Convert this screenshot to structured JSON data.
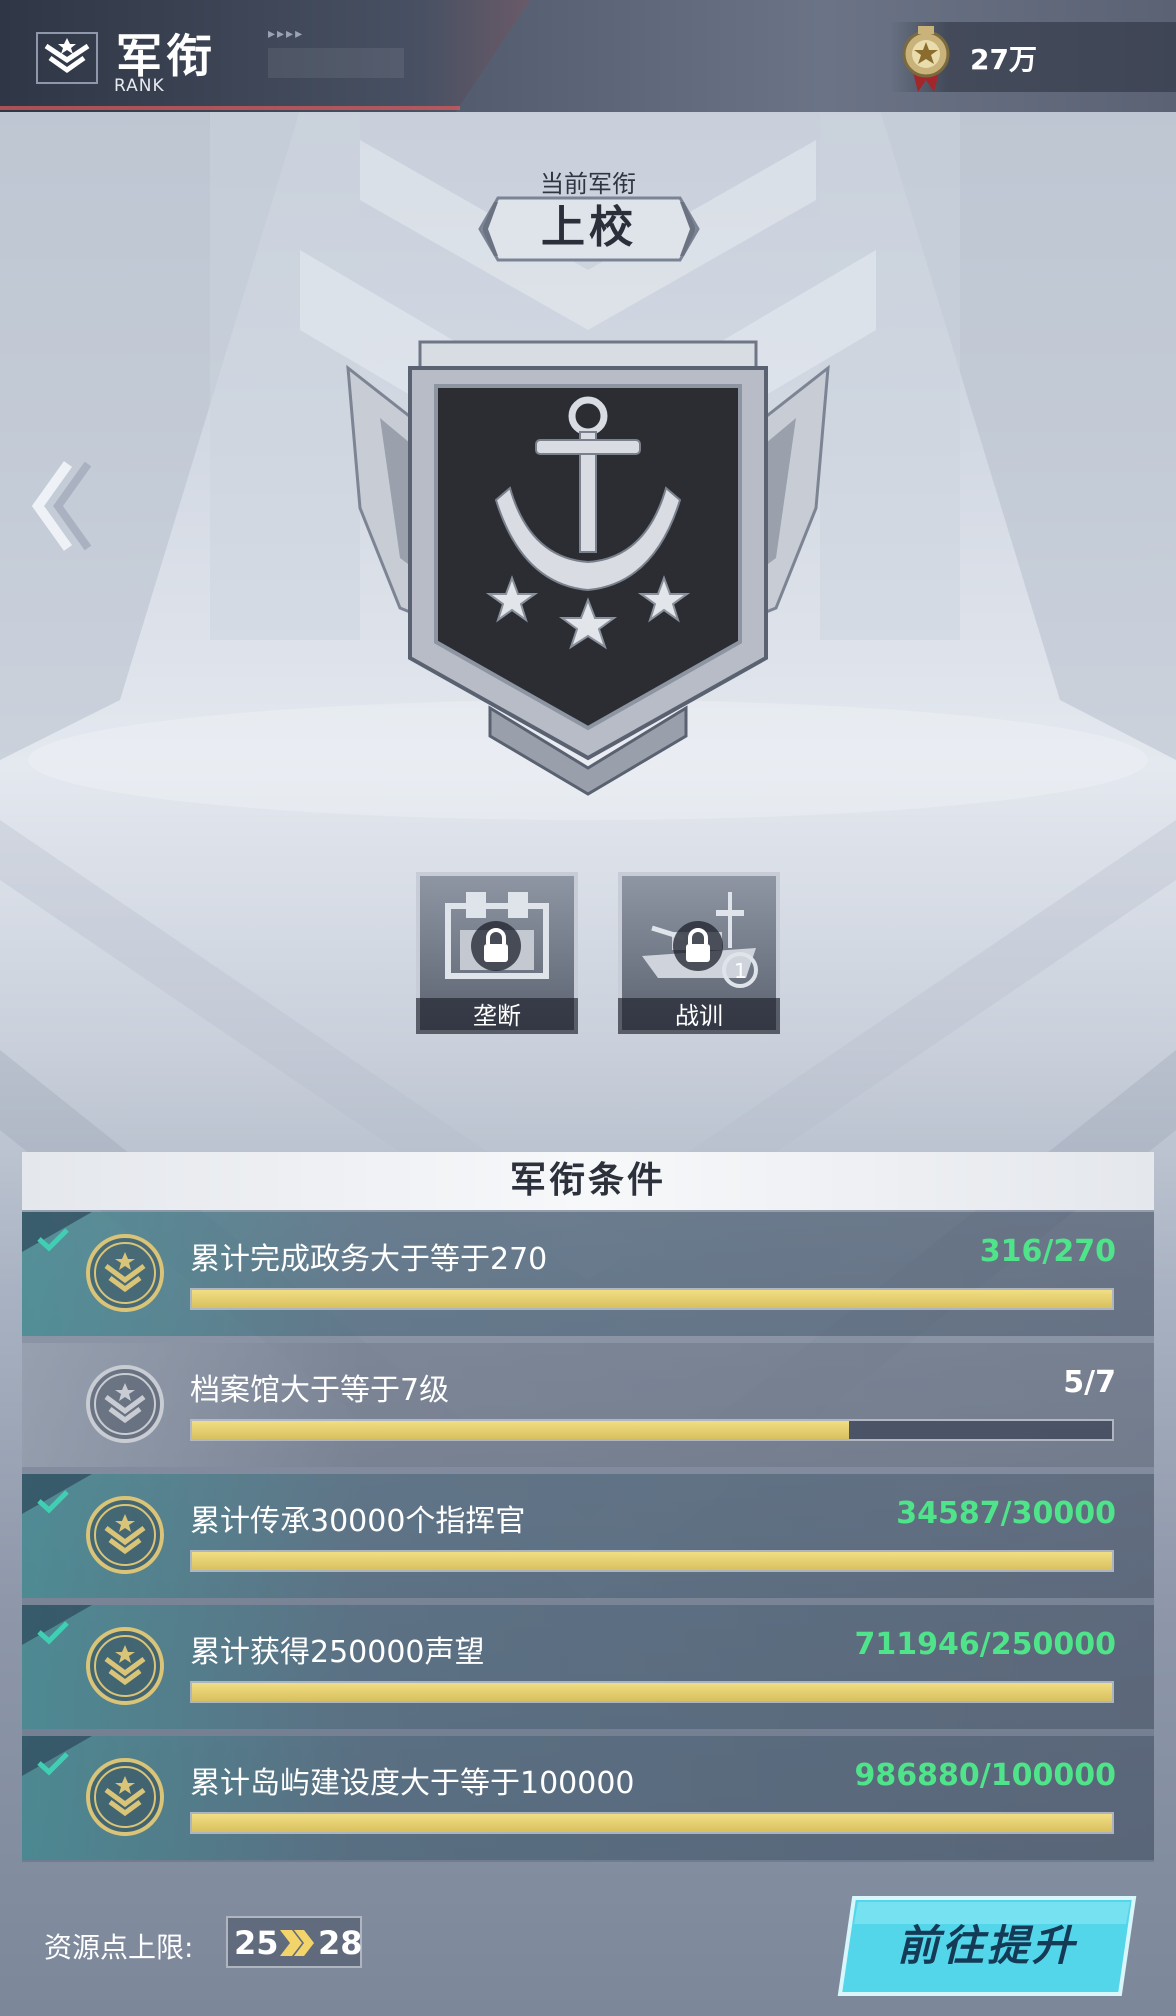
{
  "header": {
    "title": "军衔",
    "subtitle": "RANK",
    "currency_value": "27万",
    "icons": {
      "logo": "rank-chevron-icon",
      "currency": "medal-icon"
    }
  },
  "rank": {
    "label": "当前军衔",
    "name": "上校",
    "badge": "anchor-three-stars-badge"
  },
  "unlocks": [
    {
      "label": "垄断",
      "icon": "factory-lock-icon",
      "locked": true
    },
    {
      "label": "战训",
      "icon": "warship-lock-icon",
      "locked": true
    }
  ],
  "conditions": {
    "title": "军衔条件",
    "items": [
      {
        "text": "累计完成政务大于等于270",
        "count": "316/270",
        "progress": 1.0,
        "done": true
      },
      {
        "text": "档案馆大于等于7级",
        "count": "5/7",
        "progress": 0.714,
        "done": false
      },
      {
        "text": "累计传承30000个指挥官",
        "count": "34587/30000",
        "progress": 1.0,
        "done": true
      },
      {
        "text": "累计获得250000声望",
        "count": "711946/250000",
        "progress": 1.0,
        "done": true
      },
      {
        "text": "累计岛屿建设度大于等于100000",
        "count": "986880/100000",
        "progress": 1.0,
        "done": true
      }
    ]
  },
  "footer": {
    "resource_label": "资源点上限:",
    "resource_from": "25",
    "resource_to": "28",
    "go_button": "前往提升"
  },
  "colors": {
    "done_count": "#4fe38a",
    "bar_fill": "#e2cd6c",
    "go_button": "#4fd2e8"
  }
}
